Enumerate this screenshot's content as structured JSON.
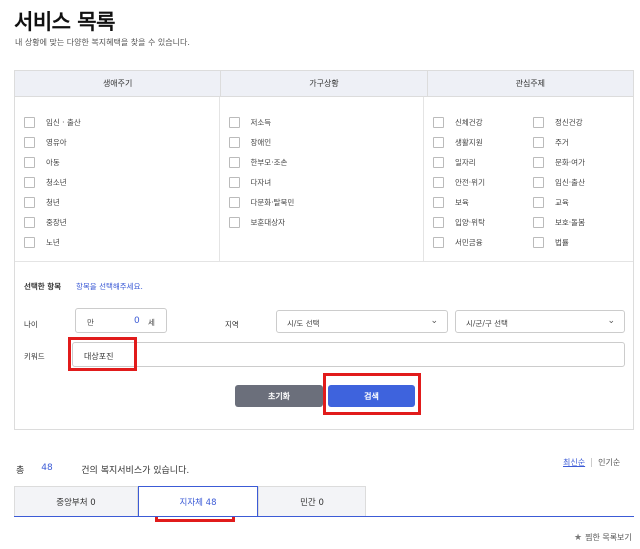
{
  "page": {
    "title": "서비스 목록",
    "subtitle": "내 상황에 맞는 다양한 복지혜택을 찾을 수 있습니다."
  },
  "filters": {
    "headers": [
      "생애주기",
      "가구상황",
      "관심주제"
    ],
    "life_cycle": [
      "임신 · 출산",
      "영유아",
      "아동",
      "청소년",
      "청년",
      "중장년",
      "노년"
    ],
    "household": [
      "저소득",
      "장애인",
      "한부모·조손",
      "다자녀",
      "다문화·탈북민",
      "보훈대상자"
    ],
    "interest_left": [
      "신체건강",
      "생활지원",
      "일자리",
      "안전·위기",
      "보육",
      "입양·위탁",
      "서민금융"
    ],
    "interest_right": [
      "정신건강",
      "주거",
      "문화·여가",
      "임신·출산",
      "교육",
      "보호·돌봄",
      "법률"
    ]
  },
  "selected": {
    "label": "선택한 항목",
    "hint": "항목을 선택해주세요."
  },
  "age": {
    "label": "나이",
    "prefix": "만",
    "value": "0",
    "unit": "세"
  },
  "region": {
    "label": "지역",
    "sido_value": "시/도 선택",
    "sigungu_value": "시/군/구 선택"
  },
  "keyword": {
    "label": "키워드",
    "value": "대상포진"
  },
  "buttons": {
    "reset": "초기화",
    "search": "검색"
  },
  "results": {
    "prefix": "총",
    "count": "48",
    "suffix": "건의 복지서비스가 있습니다.",
    "sort_latest": "최신순",
    "sort_popular": "인기순"
  },
  "tabs": [
    {
      "label": "중앙부처 0"
    },
    {
      "label": "지자체 48"
    },
    {
      "label": "민간 0"
    }
  ],
  "favorites_label": "찜한 목록보기",
  "colors": {
    "accent": "#3e63dd",
    "highlight_box": "#e11b1b",
    "header_bg": "#eef0f6"
  }
}
